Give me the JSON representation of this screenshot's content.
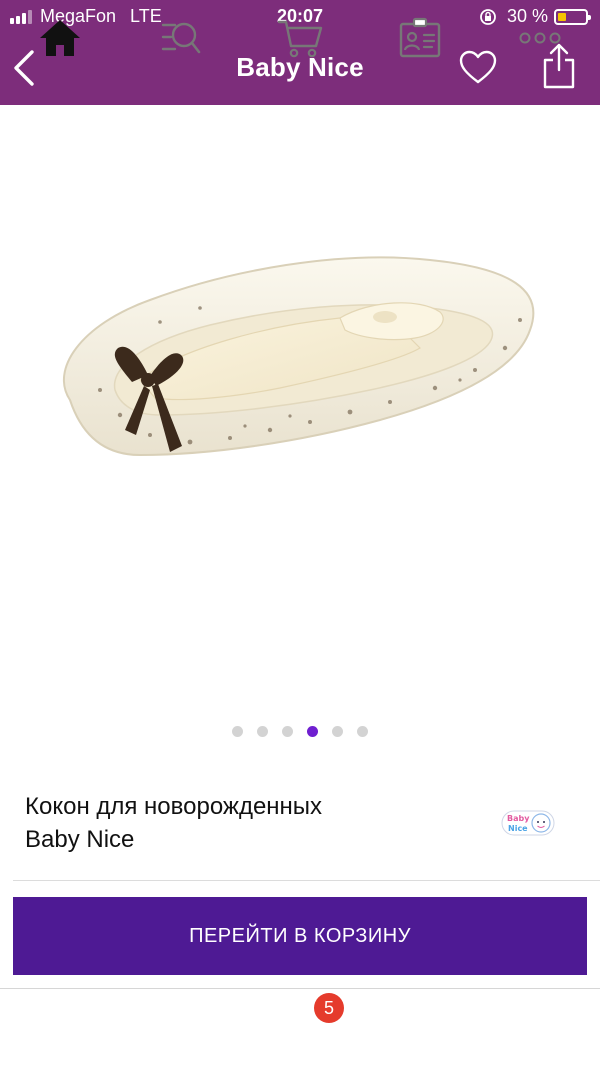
{
  "status_bar": {
    "carrier": "MegaFon",
    "network": "LTE",
    "time": "20:07",
    "battery_percent": "30 %",
    "battery_level": 0.3
  },
  "nav": {
    "title": "Baby Nice",
    "back_icon": "chevron-left-icon",
    "favorite_icon": "heart-outline-icon",
    "share_icon": "share-icon"
  },
  "gallery": {
    "image_count": 6,
    "active_index": 3
  },
  "product": {
    "title_line1": "Кокон для новорожденных",
    "title_line2": "Baby Nice",
    "brand_logo_text": "Baby Nice"
  },
  "cta": {
    "label": "ПЕРЕЙТИ В КОРЗИНУ"
  },
  "tabbar": {
    "items": [
      "home-icon",
      "catalog-search-icon",
      "cart-icon",
      "profile-card-icon",
      "more-icon"
    ],
    "active": "home",
    "cart_badge": "5"
  },
  "colors": {
    "header_bg": "#7d2d7b",
    "cta_bg": "#4e1a94",
    "active_dot": "#6f1fd0",
    "badge": "#e53b2c"
  }
}
